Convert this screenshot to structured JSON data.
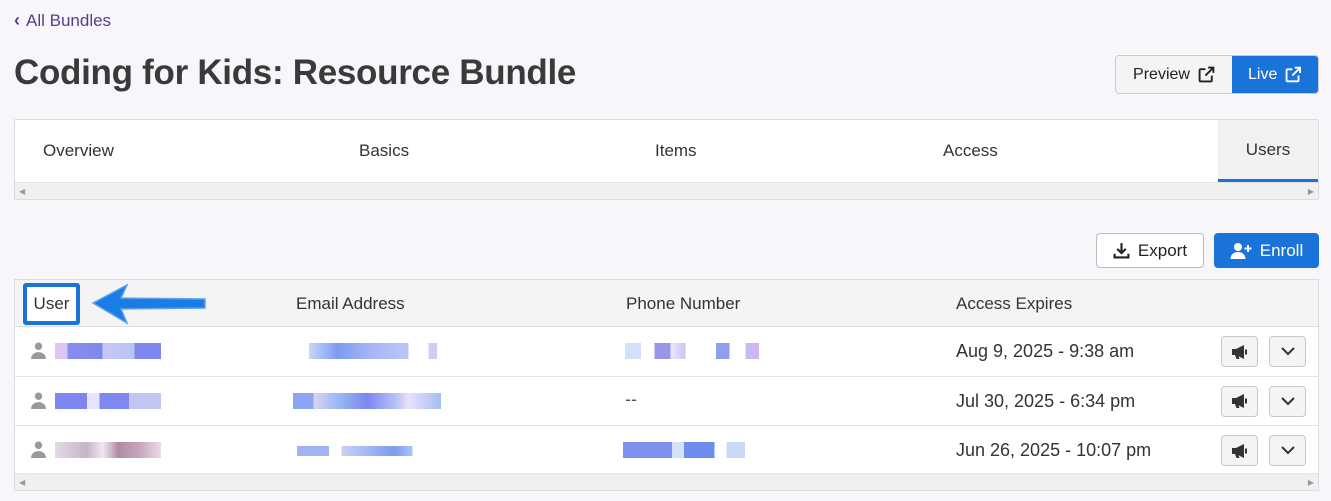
{
  "nav": {
    "back_label": "All Bundles"
  },
  "page": {
    "title": "Coding for Kids: Resource Bundle"
  },
  "header_buttons": {
    "preview_label": "Preview",
    "live_label": "Live"
  },
  "tabs": [
    {
      "label": "Overview"
    },
    {
      "label": "Basics"
    },
    {
      "label": "Items"
    },
    {
      "label": "Access"
    },
    {
      "label": "Users"
    }
  ],
  "actions": {
    "export_label": "Export",
    "enroll_label": "Enroll"
  },
  "table": {
    "columns": [
      "User",
      "Email Address",
      "Phone Number",
      "Access Expires"
    ],
    "rows": [
      {
        "phone": "",
        "expires": "Aug 9, 2025 - 9:38 am"
      },
      {
        "phone": "--",
        "expires": "Jul 30, 2025 - 6:34 pm"
      },
      {
        "phone": "",
        "expires": "Jun 26, 2025 - 10:07 pm"
      }
    ]
  },
  "colors": {
    "accent": "#1a73d9",
    "link": "#5a3d8a"
  },
  "icons": {
    "back": "chevron-left-icon",
    "external": "external-link-icon",
    "export": "download-icon",
    "enroll": "add-user-icon",
    "announce": "megaphone-icon",
    "expand": "chevron-down-icon",
    "user": "user-icon"
  }
}
